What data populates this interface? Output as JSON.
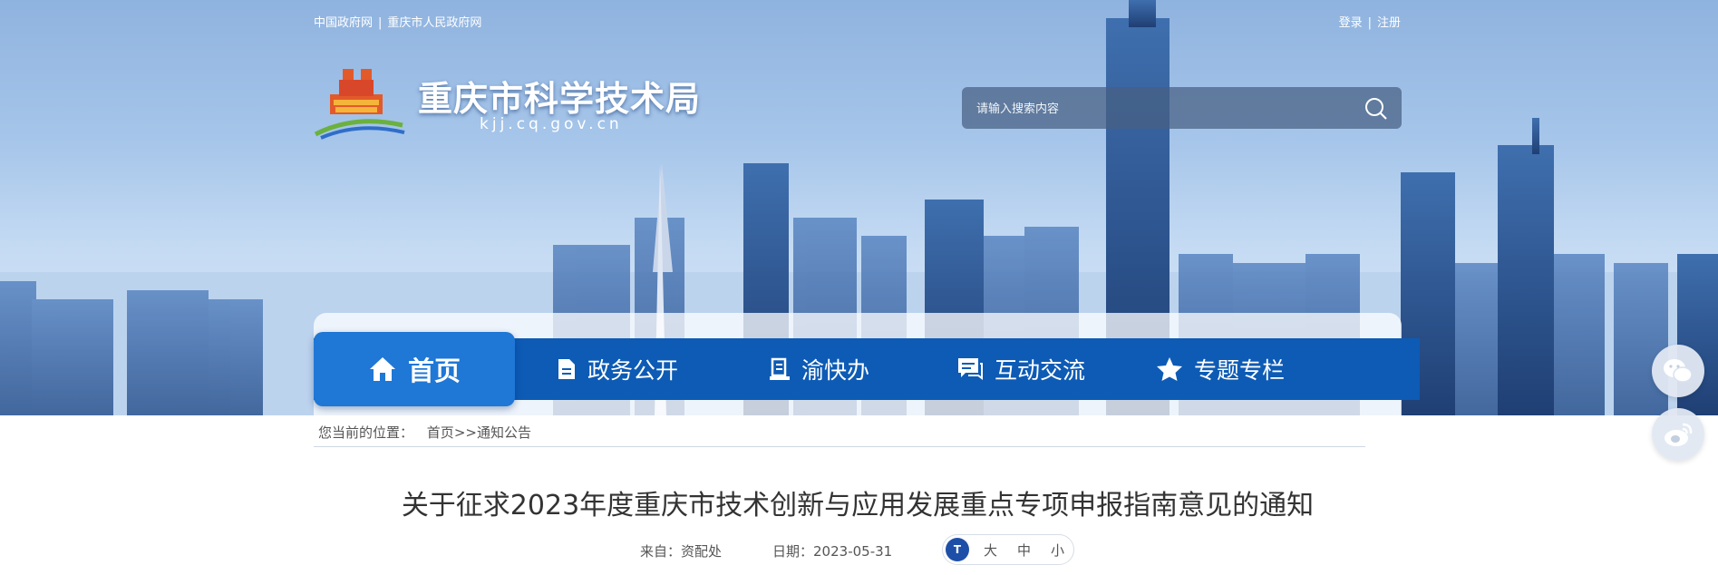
{
  "top_links": {
    "gov": "中国政府网",
    "divider": "|",
    "city_gov": "重庆市人民政府网"
  },
  "account": {
    "login": "登录",
    "divider": "|",
    "register": "注册"
  },
  "site": {
    "name": "重庆市科学技术局",
    "domain": "kjj.cq.gov.cn"
  },
  "search": {
    "placeholder": "请输入搜索内容",
    "icon": "search-icon"
  },
  "nav": {
    "home": "首页",
    "items": [
      "政务公开",
      "渝快办",
      "互动交流",
      "专题专栏"
    ],
    "icons": [
      "home-icon",
      "document-icon",
      "service-icon",
      "chat-icon",
      "star-icon"
    ]
  },
  "breadcrumb": {
    "label": "您当前的位置：",
    "home": "首页",
    "separator": ">>",
    "current": "通知公告"
  },
  "article": {
    "title": "关于征求2023年度重庆市技术创新与应用发展重点专项申报指南意见的通知",
    "source_label": "来自：",
    "source": "资配处",
    "date_label": "日期：",
    "date": "2023-05-31"
  },
  "font_size": {
    "icon_text": "T",
    "large": "大",
    "medium": "中",
    "small": "小"
  },
  "share": [
    "wechat-icon",
    "weibo-icon"
  ],
  "colors": {
    "nav_bar": "#0d5bb5",
    "nav_active": "#1f77d6",
    "fontsize_icon": "#1e4fa8"
  }
}
